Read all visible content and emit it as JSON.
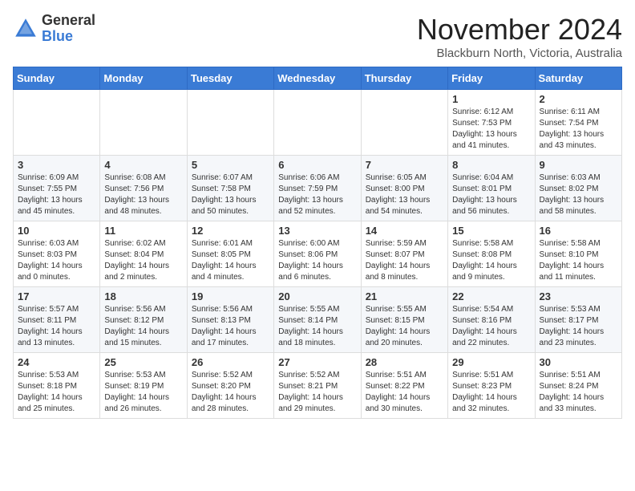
{
  "logo": {
    "general": "General",
    "blue": "Blue"
  },
  "header": {
    "month": "November 2024",
    "location": "Blackburn North, Victoria, Australia"
  },
  "weekdays": [
    "Sunday",
    "Monday",
    "Tuesday",
    "Wednesday",
    "Thursday",
    "Friday",
    "Saturday"
  ],
  "weeks": [
    [
      {
        "day": "",
        "info": ""
      },
      {
        "day": "",
        "info": ""
      },
      {
        "day": "",
        "info": ""
      },
      {
        "day": "",
        "info": ""
      },
      {
        "day": "",
        "info": ""
      },
      {
        "day": "1",
        "info": "Sunrise: 6:12 AM\nSunset: 7:53 PM\nDaylight: 13 hours\nand 41 minutes."
      },
      {
        "day": "2",
        "info": "Sunrise: 6:11 AM\nSunset: 7:54 PM\nDaylight: 13 hours\nand 43 minutes."
      }
    ],
    [
      {
        "day": "3",
        "info": "Sunrise: 6:09 AM\nSunset: 7:55 PM\nDaylight: 13 hours\nand 45 minutes."
      },
      {
        "day": "4",
        "info": "Sunrise: 6:08 AM\nSunset: 7:56 PM\nDaylight: 13 hours\nand 48 minutes."
      },
      {
        "day": "5",
        "info": "Sunrise: 6:07 AM\nSunset: 7:58 PM\nDaylight: 13 hours\nand 50 minutes."
      },
      {
        "day": "6",
        "info": "Sunrise: 6:06 AM\nSunset: 7:59 PM\nDaylight: 13 hours\nand 52 minutes."
      },
      {
        "day": "7",
        "info": "Sunrise: 6:05 AM\nSunset: 8:00 PM\nDaylight: 13 hours\nand 54 minutes."
      },
      {
        "day": "8",
        "info": "Sunrise: 6:04 AM\nSunset: 8:01 PM\nDaylight: 13 hours\nand 56 minutes."
      },
      {
        "day": "9",
        "info": "Sunrise: 6:03 AM\nSunset: 8:02 PM\nDaylight: 13 hours\nand 58 minutes."
      }
    ],
    [
      {
        "day": "10",
        "info": "Sunrise: 6:03 AM\nSunset: 8:03 PM\nDaylight: 14 hours\nand 0 minutes."
      },
      {
        "day": "11",
        "info": "Sunrise: 6:02 AM\nSunset: 8:04 PM\nDaylight: 14 hours\nand 2 minutes."
      },
      {
        "day": "12",
        "info": "Sunrise: 6:01 AM\nSunset: 8:05 PM\nDaylight: 14 hours\nand 4 minutes."
      },
      {
        "day": "13",
        "info": "Sunrise: 6:00 AM\nSunset: 8:06 PM\nDaylight: 14 hours\nand 6 minutes."
      },
      {
        "day": "14",
        "info": "Sunrise: 5:59 AM\nSunset: 8:07 PM\nDaylight: 14 hours\nand 8 minutes."
      },
      {
        "day": "15",
        "info": "Sunrise: 5:58 AM\nSunset: 8:08 PM\nDaylight: 14 hours\nand 9 minutes."
      },
      {
        "day": "16",
        "info": "Sunrise: 5:58 AM\nSunset: 8:10 PM\nDaylight: 14 hours\nand 11 minutes."
      }
    ],
    [
      {
        "day": "17",
        "info": "Sunrise: 5:57 AM\nSunset: 8:11 PM\nDaylight: 14 hours\nand 13 minutes."
      },
      {
        "day": "18",
        "info": "Sunrise: 5:56 AM\nSunset: 8:12 PM\nDaylight: 14 hours\nand 15 minutes."
      },
      {
        "day": "19",
        "info": "Sunrise: 5:56 AM\nSunset: 8:13 PM\nDaylight: 14 hours\nand 17 minutes."
      },
      {
        "day": "20",
        "info": "Sunrise: 5:55 AM\nSunset: 8:14 PM\nDaylight: 14 hours\nand 18 minutes."
      },
      {
        "day": "21",
        "info": "Sunrise: 5:55 AM\nSunset: 8:15 PM\nDaylight: 14 hours\nand 20 minutes."
      },
      {
        "day": "22",
        "info": "Sunrise: 5:54 AM\nSunset: 8:16 PM\nDaylight: 14 hours\nand 22 minutes."
      },
      {
        "day": "23",
        "info": "Sunrise: 5:53 AM\nSunset: 8:17 PM\nDaylight: 14 hours\nand 23 minutes."
      }
    ],
    [
      {
        "day": "24",
        "info": "Sunrise: 5:53 AM\nSunset: 8:18 PM\nDaylight: 14 hours\nand 25 minutes."
      },
      {
        "day": "25",
        "info": "Sunrise: 5:53 AM\nSunset: 8:19 PM\nDaylight: 14 hours\nand 26 minutes."
      },
      {
        "day": "26",
        "info": "Sunrise: 5:52 AM\nSunset: 8:20 PM\nDaylight: 14 hours\nand 28 minutes."
      },
      {
        "day": "27",
        "info": "Sunrise: 5:52 AM\nSunset: 8:21 PM\nDaylight: 14 hours\nand 29 minutes."
      },
      {
        "day": "28",
        "info": "Sunrise: 5:51 AM\nSunset: 8:22 PM\nDaylight: 14 hours\nand 30 minutes."
      },
      {
        "day": "29",
        "info": "Sunrise: 5:51 AM\nSunset: 8:23 PM\nDaylight: 14 hours\nand 32 minutes."
      },
      {
        "day": "30",
        "info": "Sunrise: 5:51 AM\nSunset: 8:24 PM\nDaylight: 14 hours\nand 33 minutes."
      }
    ]
  ]
}
